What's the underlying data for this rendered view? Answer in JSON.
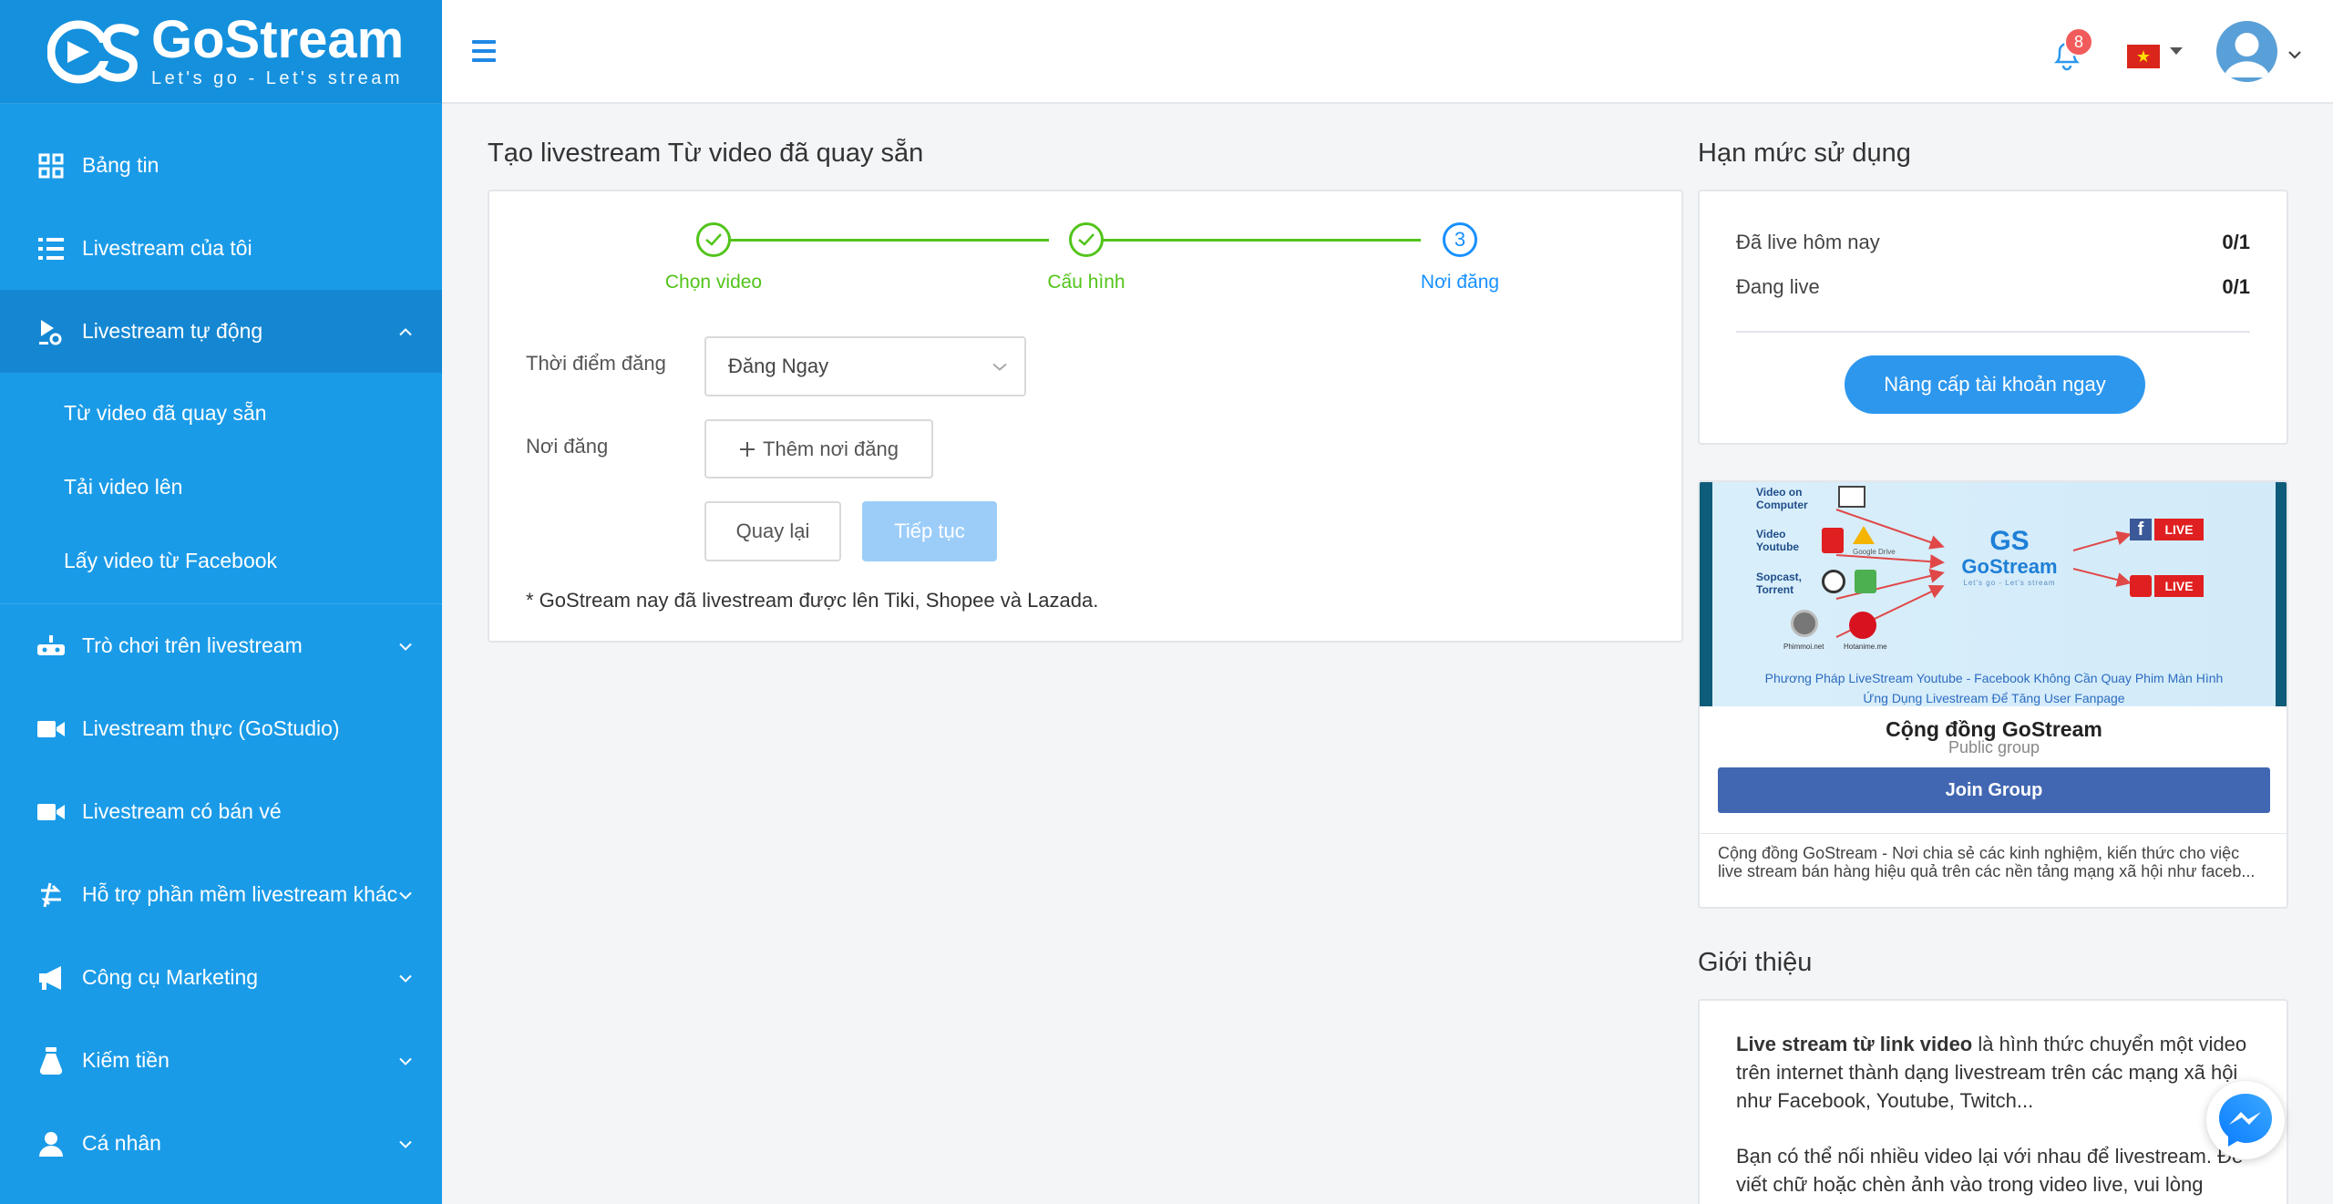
{
  "brand": {
    "name": "GoStream",
    "tagline": "Let's go - Let's stream"
  },
  "sidebar": {
    "items": [
      {
        "label": "Bảng tin",
        "icon": "dashboard-icon"
      },
      {
        "label": "Livestream của tôi",
        "icon": "list-icon"
      },
      {
        "label": "Livestream tự động",
        "icon": "auto-stream-icon",
        "expanded": true,
        "children": [
          "Từ video đã quay sẵn",
          "Tải video lên",
          "Lấy video từ Facebook"
        ]
      },
      {
        "label": "Trò chơi trên livestream",
        "icon": "gamepad-icon"
      },
      {
        "label": "Livestream thực (GoStudio)",
        "icon": "video-camera-icon"
      },
      {
        "label": "Livestream có bán vé",
        "icon": "video-camera-icon"
      },
      {
        "label": "Hỗ trợ phần mềm livestream khác",
        "icon": "transfer-icon"
      },
      {
        "label": "Công cụ Marketing",
        "icon": "megaphone-icon"
      },
      {
        "label": "Kiếm tiền",
        "icon": "money-bag-icon"
      },
      {
        "label": "Cá nhân",
        "icon": "user-icon"
      }
    ]
  },
  "header": {
    "notification_count": "8",
    "flag_star": "★"
  },
  "main": {
    "title": "Tạo livestream Từ video đã quay sẵn",
    "steps": [
      {
        "label": "Chọn video",
        "status": "done"
      },
      {
        "label": "Cấu hình",
        "status": "done"
      },
      {
        "label": "Nơi đăng",
        "status": "current",
        "number": "3"
      }
    ],
    "form": {
      "time_label": "Thời điểm đăng",
      "time_value": "Đăng Ngay",
      "place_label": "Nơi đăng",
      "add_place_button": "Thêm nơi đăng",
      "back_button": "Quay lại",
      "next_button": "Tiếp tục"
    },
    "note": "* GoStream nay đã livestream được lên Tiki, Shopee và Lazada."
  },
  "quota": {
    "title": "Hạn mức sử dụng",
    "rows": [
      {
        "label": "Đã live hôm nay",
        "value": "0/1"
      },
      {
        "label": "Đang live",
        "value": "0/1"
      }
    ],
    "upgrade_button": "Nâng cấp tài khoản ngay"
  },
  "community": {
    "banner": {
      "sources": [
        "Video on Computer",
        "Video Youtube",
        "Sopcast, Torrent"
      ],
      "small_labels": [
        "Google Drive",
        "Phimmoi.net",
        "Hotanime.me"
      ],
      "live_label": "LIVE",
      "brand": "GoStream",
      "tagline": "Let's go - Let's stream",
      "caption_line1": "Phương Pháp LiveStream Youtube - Facebook Không Cần Quay Phim Màn Hình",
      "caption_line2": "Ứng Dụng Livestream Để Tăng User Fanpage"
    },
    "group_name": "Cộng đồng GoStream",
    "group_type": "Public group",
    "join_button": "Join Group",
    "description": "Cộng đồng GoStream - Nơi chia sẻ các kinh nghiệm, kiến thức cho việc live stream bán hàng hiệu quả trên các nền tảng mạng xã hội như faceb..."
  },
  "intro": {
    "title": "Giới thiệu",
    "p1_bold": "Live stream từ link video",
    "p1_rest": " là hình thức chuyển một video trên internet thành dạng livestream trên các mạng xã hội như Facebook, Youtube, Twitch...",
    "p2": "Bạn có thể nối nhiều video lại với nhau để livestream. Để viết chữ hoặc chèn ảnh vào trong video live, vui lòng"
  },
  "colors": {
    "sidebar": "#1a9be8",
    "accent": "#1890ff",
    "success": "#52c41a",
    "facebook": "#4267b2"
  }
}
